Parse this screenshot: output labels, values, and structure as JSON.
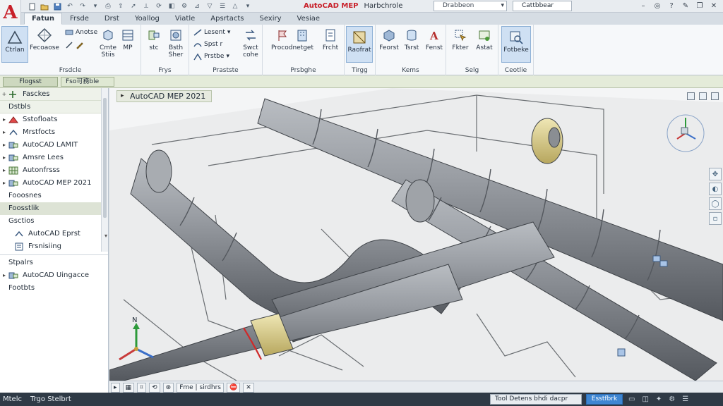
{
  "app": {
    "logo": "A",
    "title_app": "AutoCAD MEP",
    "title_doc": "Harbchrole",
    "search_text": "Drabbeon",
    "user_text": "Cattbbear"
  },
  "ribbon_tabs": [
    {
      "label": "Fatun",
      "active": true
    },
    {
      "label": "Frsde",
      "active": false
    },
    {
      "label": "Drst",
      "active": false
    },
    {
      "label": "Yoallog",
      "active": false
    },
    {
      "label": "Viatle",
      "active": false
    },
    {
      "label": "Apsrtacts",
      "active": false
    },
    {
      "label": "Sexiry",
      "active": false
    },
    {
      "label": "Vesiae",
      "active": false
    }
  ],
  "ribbon": {
    "btn_ctrltan": "Ctrlan",
    "btn_fecoaose": "Fecoaose",
    "r1_anotse": "Anotse",
    "btn_crmte": "Cmte",
    "btn_stiis": "Stiis",
    "btn_mp": "MP",
    "group1_label": "Frsdcle",
    "btn_stel_ndtc": "stc",
    "btn_bstlh": "Bsth",
    "btn_bstlh2": "Sher",
    "group2_label": "Frys",
    "r_lesent": "Lesent",
    "r_spst": "Spst r",
    "r_prstb": "Prstbe",
    "btn_swt": "Swct",
    "btn_swt2": "cohe",
    "group3_label": "Prastste",
    "btn_procodnnt": "Procodnetget",
    "btn_frmt": "Frcht",
    "group4_label": "Prsbghe",
    "btn_rasfat": "Raofrat",
    "group5_label": "Tirgg",
    "btn_fecast": "Feorst",
    "btn_tscst": "Tsrst",
    "btn_fenst": "Fenst",
    "group6_label": "Kems",
    "btn_fkter": "Fkter",
    "btn_astat": "Astat",
    "group7_label": "Selg",
    "btn_fotbeke": "Fotbeke",
    "group8_label": "Ceotlie"
  },
  "strip": {
    "label": "Flogsst",
    "file": "Fso可務ble"
  },
  "tree": [
    {
      "label": "Fasckes",
      "twisty": "+",
      "kind": "top",
      "icon": "plus-icon"
    },
    {
      "label": "Dstbls",
      "twisty": "",
      "kind": "top",
      "icon": ""
    },
    {
      "label": "Sstofloats",
      "twisty": "▸",
      "kind": "item",
      "icon": "pipe-red-icon"
    },
    {
      "label": "Mrstfocts",
      "twisty": "▸",
      "kind": "item",
      "icon": "duct-icon"
    },
    {
      "label": "AutoCAD LAMIT",
      "twisty": "▸",
      "kind": "item",
      "icon": "fitting-icon"
    },
    {
      "label": "Amsre Lees",
      "twisty": "▸",
      "kind": "item",
      "icon": "fitting-icon"
    },
    {
      "label": "Autonfrsss",
      "twisty": "▸",
      "kind": "item",
      "icon": "grid-icon"
    },
    {
      "label": "AutoCAD MEP 2021",
      "twisty": "▸",
      "kind": "item",
      "icon": "fitting-icon"
    },
    {
      "label": "Fooosnes",
      "twisty": "",
      "kind": "item",
      "icon": ""
    },
    {
      "label": "Foosstlik",
      "twisty": "",
      "kind": "hl",
      "icon": ""
    },
    {
      "label": "Gsctios",
      "twisty": "",
      "kind": "item",
      "icon": ""
    },
    {
      "label": "AutoCAD Eprst",
      "twisty": "",
      "kind": "sub",
      "icon": "duct-icon"
    },
    {
      "label": "Frsnisiing",
      "twisty": "",
      "kind": "sub",
      "icon": "doc-icon"
    },
    {
      "label": "Stpalrs",
      "twisty": "",
      "kind": "sep",
      "icon": ""
    },
    {
      "label": "AutoCAD Uingacce",
      "twisty": "▸",
      "kind": "item",
      "icon": "fitting-icon"
    },
    {
      "label": "Footbts",
      "twisty": "",
      "kind": "item",
      "icon": ""
    }
  ],
  "viewport": {
    "title": "AutoCAD MEP 2021",
    "axis_label": "N"
  },
  "layout_tabs": {
    "t1": "▸",
    "t2": "Fme | sirdhrs"
  },
  "statusbar": {
    "left1": "Mtelc",
    "left2": "Trgo Stelbrt",
    "model_text": "Tool Detens bhdi dacpr",
    "button_text": "Esstfbrk"
  },
  "colors": {
    "accent": "#3e86d2",
    "ribbon_bg": "#f6f8fa",
    "pipe": "#8e9297",
    "status_bg": "#2f3a46",
    "logo_red": "#c8202a"
  }
}
